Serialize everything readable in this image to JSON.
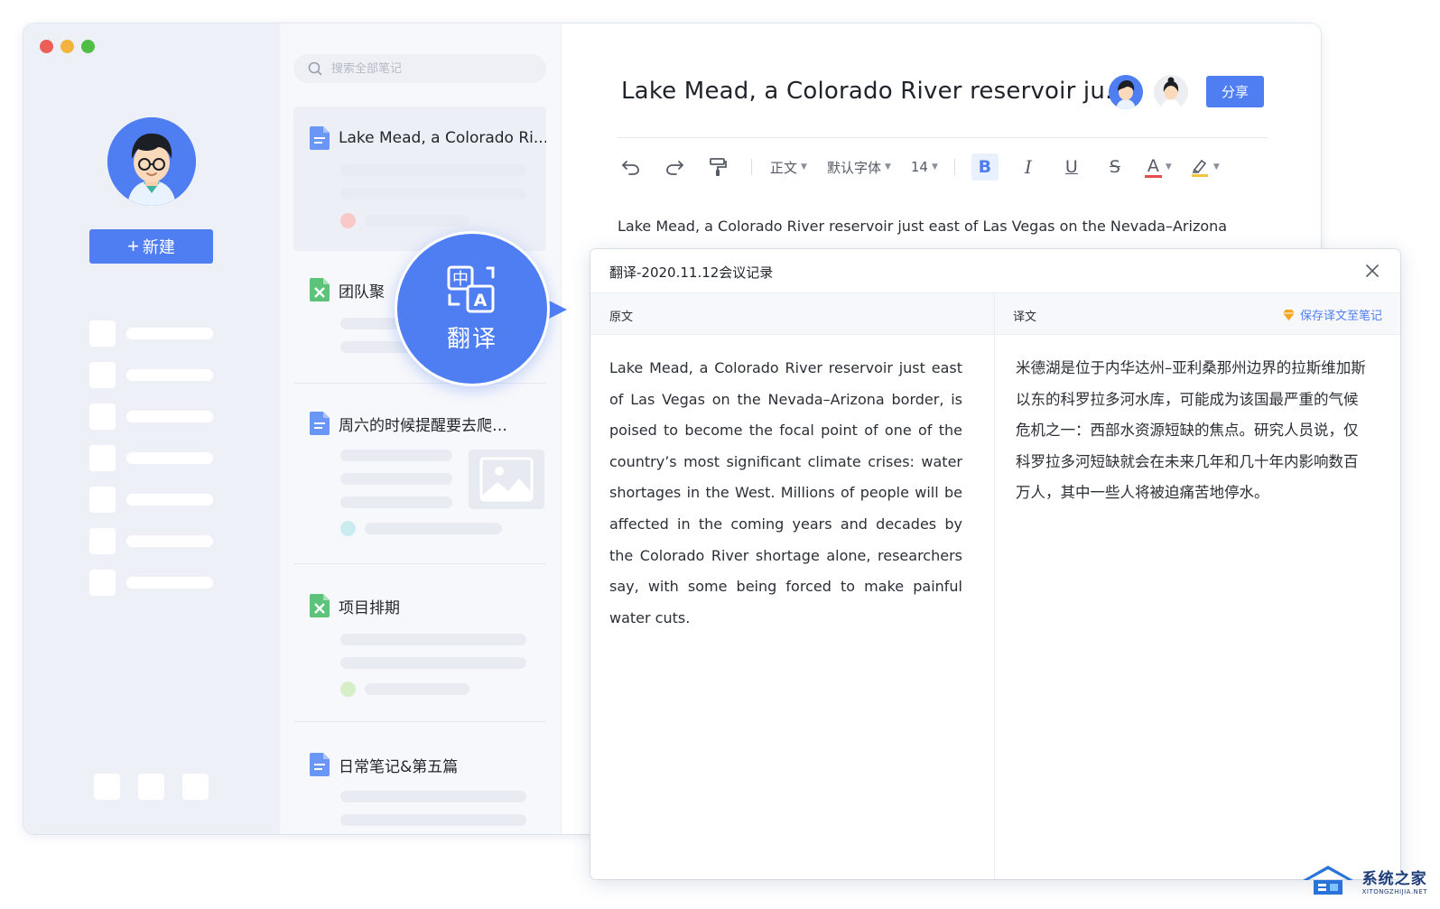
{
  "window": {
    "traffic_lights": [
      "#ec5f57",
      "#f2b43c",
      "#4ebf42"
    ],
    "accent": "#4f7ef3"
  },
  "sidebar": {
    "new_button_label": "新建",
    "new_button_icon": "plus-icon"
  },
  "notelist": {
    "search_placeholder": "搜索全部笔记",
    "notes": [
      {
        "title": "Lake Mead, a Colorado Ri...",
        "icon": "doc-icon",
        "dot_color": "#f9c8c8",
        "selected": true
      },
      {
        "title": "团队聚",
        "icon": "sheet-icon"
      },
      {
        "title": "周六的时候提醒要去爬…",
        "icon": "doc-icon",
        "dot_color": "#c9ecef",
        "has_image_thumb": true
      },
      {
        "title": "项目排期",
        "icon": "sheet-icon",
        "dot_color": "#d6efc9"
      },
      {
        "title": "日常笔记&第五篇",
        "icon": "doc-icon"
      }
    ]
  },
  "editor": {
    "title": "Lake Mead, a Colorado River reservoir ju...",
    "share_label": "分享",
    "toolbar": {
      "paragraph_style": "正文",
      "font_family": "默认字体",
      "font_size": "14",
      "bold": "B",
      "italic": "I",
      "underline": "U",
      "strike": "S",
      "font_color": "A"
    },
    "body": "Lake Mead, a Colorado River reservoir just east of Las Vegas on the Nevada–Arizona"
  },
  "translate_bubble": {
    "label": "翻译"
  },
  "translation_panel": {
    "title": "翻译-2020.11.12会议记录",
    "original_header": "原文",
    "translated_header": "译文",
    "save_link": "保存译文至笔记",
    "original_text": "Lake Mead, a Colorado River reservoir just east of Las Vegas on the Nevada–Arizona border, is poised to become the focal point of one of the country’s most significant climate crises: water shortages in the West. Millions of people will be affected in the coming years and decades by the Colorado River shortage alone, researchers say, with some being forced to make painful water cuts.",
    "translated_text": "米德湖是位于内华达州–亚利桑那州边界的拉斯维加斯以东的科罗拉多河水库，可能成为该国最严重的气候危机之一：西部水资源短缺的焦点。研究人员说，仅科罗拉多河短缺就会在未来几年和几十年内影响数百万人，其中一些人将被迫痛苦地停水。"
  },
  "watermark": {
    "cn": "系统之家",
    "en": "XITONGZHIJIA.NET"
  }
}
